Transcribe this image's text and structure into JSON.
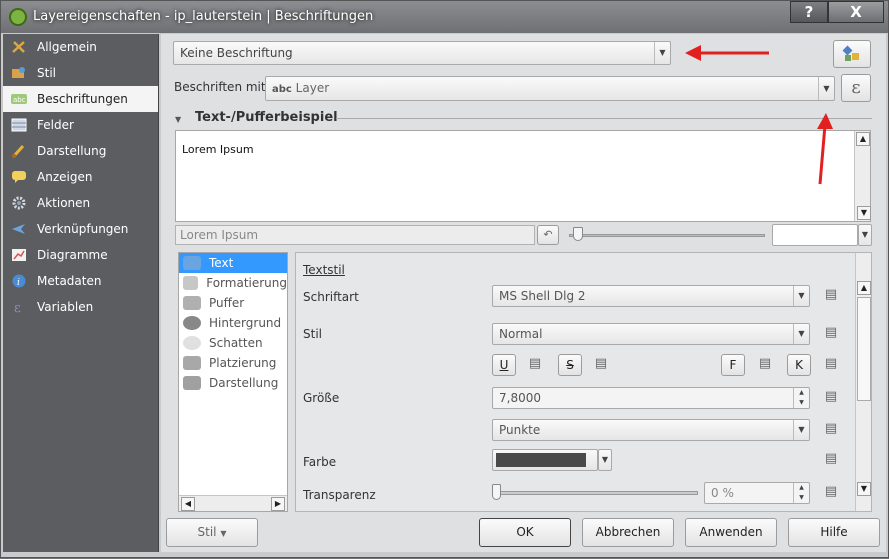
{
  "window": {
    "title": "Layereigenschaften - ip_lauterstein | Beschriftungen",
    "help_label": "?",
    "close_label": "X"
  },
  "sidebar": {
    "items": [
      {
        "label": "Allgemein",
        "icon": "tools-icon"
      },
      {
        "label": "Stil",
        "icon": "style-icon"
      },
      {
        "label": "Beschriftungen",
        "icon": "labels-icon"
      },
      {
        "label": "Felder",
        "icon": "table-icon"
      },
      {
        "label": "Darstellung",
        "icon": "brush-icon"
      },
      {
        "label": "Anzeigen",
        "icon": "speech-bubble-icon"
      },
      {
        "label": "Aktionen",
        "icon": "gear-icon"
      },
      {
        "label": "Verknüpfungen",
        "icon": "join-icon"
      },
      {
        "label": "Diagramme",
        "icon": "chart-icon"
      },
      {
        "label": "Metadaten",
        "icon": "info-icon"
      },
      {
        "label": "Variablen",
        "icon": "variable-icon"
      }
    ],
    "selected": "Beschriftungen"
  },
  "labeling": {
    "mode_value": "Keine Beschriftung",
    "label_with_text": "Beschriften mit",
    "field_prefix": "abc",
    "field_value": "Layer",
    "expression_symbol": "ε"
  },
  "preview": {
    "section_title": "Text-/Pufferbeispiel",
    "sample_text": "Lorem Ipsum",
    "sample_input_value": "Lorem Ipsum"
  },
  "tree": {
    "items": [
      {
        "label": "Text",
        "icon": "abc-icon"
      },
      {
        "label": "Formatierung",
        "icon": "format-icon"
      },
      {
        "label": "Puffer",
        "icon": "buffer-icon"
      },
      {
        "label": "Hintergrund",
        "icon": "background-icon"
      },
      {
        "label": "Schatten",
        "icon": "shadow-icon"
      },
      {
        "label": "Platzierung",
        "icon": "placement-icon"
      },
      {
        "label": "Darstellung",
        "icon": "render-icon"
      }
    ],
    "selected": "Text"
  },
  "textstyle": {
    "heading": "Textstil",
    "font_label": "Schriftart",
    "font_value": "MS Shell Dlg 2",
    "style_label": "Stil",
    "style_value": "Normal",
    "underline": "U",
    "strike": "S",
    "bold": "F",
    "italic": "K",
    "size_label": "Größe",
    "size_value": "7,8000",
    "unit_value": "Punkte",
    "color_label": "Farbe",
    "color_value": "#4a4a4a",
    "transparency_label": "Transparenz",
    "transparency_value": "0 %"
  },
  "footer": {
    "style_button": "Stil",
    "ok": "OK",
    "cancel": "Abbrechen",
    "apply": "Anwenden",
    "help": "Hilfe"
  },
  "colors": {
    "accent": "#3399ff",
    "arrow": "#e32020"
  }
}
